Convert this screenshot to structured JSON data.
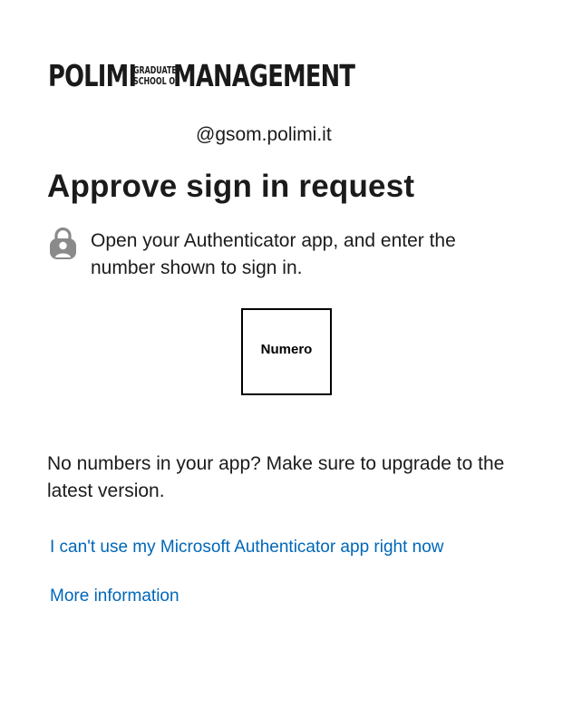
{
  "logo": {
    "left_word": "POLIMI",
    "stack_top": "GRADUATE",
    "stack_bottom": "SCHOOL OF",
    "right_word": "MANAGEMENT"
  },
  "account": {
    "email": "@gsom.polimi.it"
  },
  "heading": {
    "title": "Approve sign in request"
  },
  "instruction": {
    "icon": "lock-person-icon",
    "text": "Open your Authenticator app, and enter the number shown to sign in."
  },
  "number_box": {
    "value": "Numero"
  },
  "note": {
    "text": "No numbers in your app? Make sure to upgrade to the latest version."
  },
  "links": {
    "cant_use": "I can't use my Microsoft Authenticator app right now",
    "more_info": "More information"
  },
  "colors": {
    "link": "#0067b8",
    "text": "#1b1b1b",
    "icon": "#8a8a8a"
  }
}
